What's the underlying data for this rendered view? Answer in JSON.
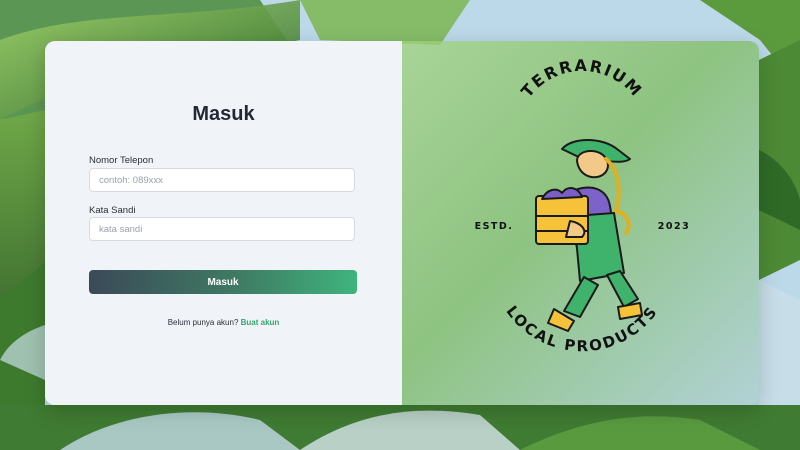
{
  "login": {
    "title": "Masuk",
    "phone_label": "Nomor Telepon",
    "phone_placeholder": "contoh: 089xxx",
    "phone_value": "",
    "password_label": "Kata Sandi",
    "password_placeholder": "kata sandi",
    "password_value": "",
    "submit_label": "Masuk",
    "signup_prompt": "Belum punya akun?",
    "signup_link": "Buat akun"
  },
  "brand": {
    "arc_top": "TERRARIUM",
    "arc_bottom": "LOCAL PRODUCTS",
    "left_text": "ESTD.",
    "right_text": "2023"
  },
  "colors": {
    "accent": "#3fb47d",
    "button_start": "#3b4a58",
    "panel_bg": "#f0f3f7",
    "title": "#222836"
  }
}
